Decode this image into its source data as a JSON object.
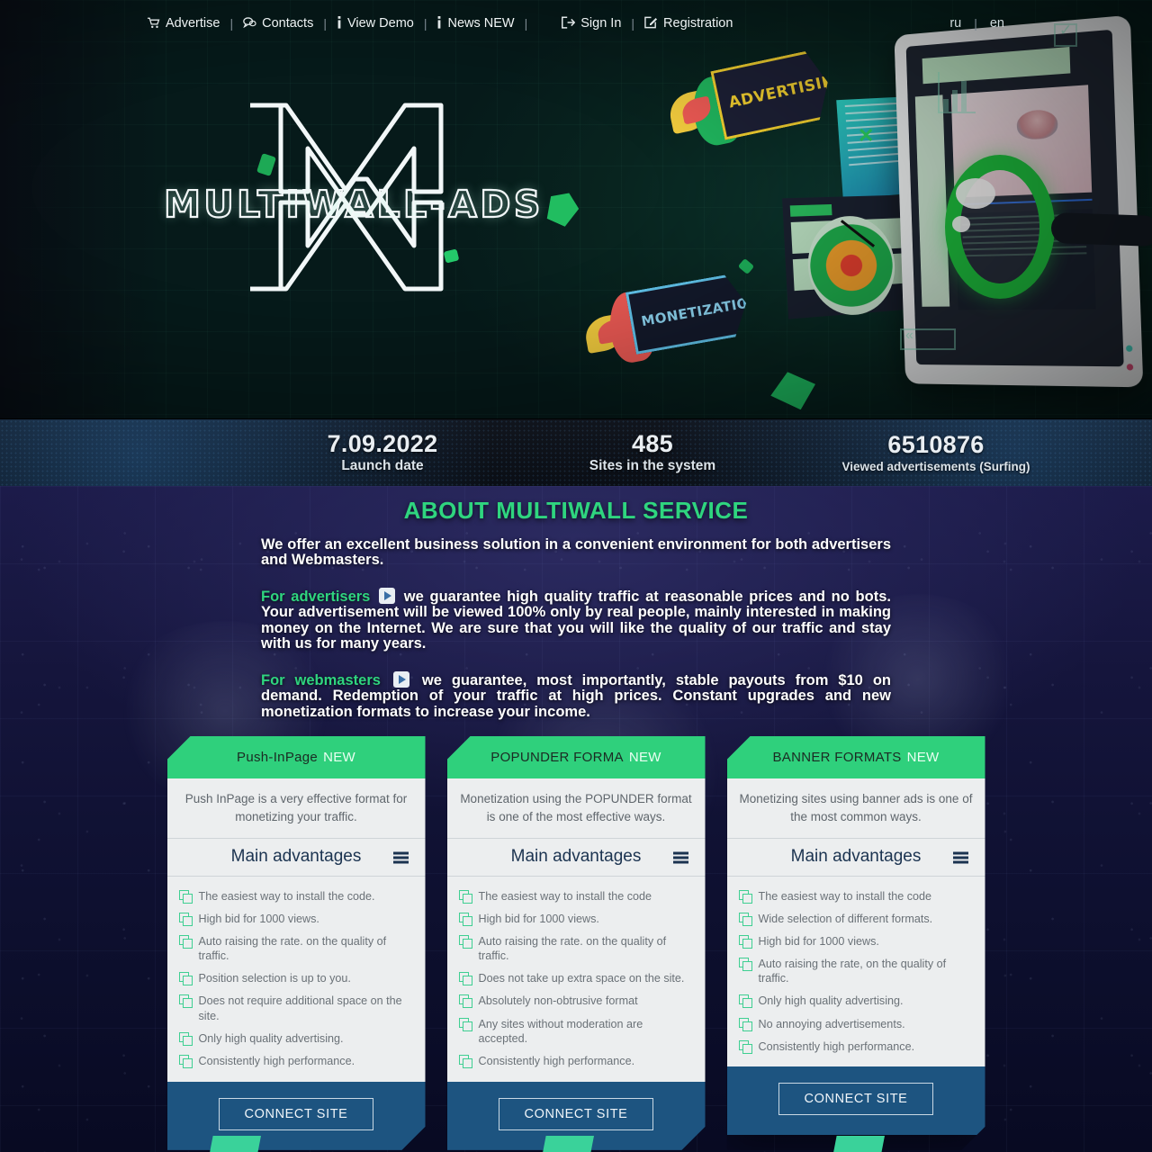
{
  "topnav": {
    "items": [
      {
        "label": "Advertise",
        "icon": "cart-icon",
        "glyph": "🛒"
      },
      {
        "label": "Contacts",
        "icon": "chat-icon",
        "glyph": "💬"
      },
      {
        "label": "View Demo",
        "icon": "info-icon",
        "glyph": "ℹ"
      },
      {
        "label": "News NEW",
        "icon": "info-icon",
        "glyph": "ℹ"
      }
    ],
    "separator": "|",
    "auth": [
      {
        "label": "Sign In",
        "icon": "sign-in-icon",
        "glyph": "➡"
      },
      {
        "label": "Registration",
        "icon": "register-icon",
        "glyph": "✎"
      }
    ],
    "languages": [
      {
        "code": "ru",
        "label": "ru"
      },
      {
        "code": "en",
        "label": "en"
      }
    ]
  },
  "hero": {
    "logo_text": "MULTIWALL-ADS",
    "logo_letter": "M",
    "badge_advertising": "ADVERTISING",
    "badge_monetization": "MONETIZATION"
  },
  "stats": [
    {
      "value": "7.09.2022",
      "label": "Launch date"
    },
    {
      "value": "485",
      "label": "Sites in the system"
    },
    {
      "value": "6510876",
      "label": "Viewed advertisements (Surfing)"
    }
  ],
  "about": {
    "title": "ABOUT MULTIWALL SERVICE",
    "intro": "We offer an excellent business solution in a convenient environment for both advertisers and Webmasters.",
    "advertisers_label": "For advertisers",
    "advertisers_text": "we guarantee high quality traffic at reasonable prices and no bots. Your advertisement will be viewed 100% only by real people, mainly interested in making money on the Internet. We are sure that you will like the quality of our traffic and stay with us for many years.",
    "webmasters_label": "For webmasters",
    "webmasters_text": "we guarantee, most importantly, stable payouts from $10 on demand. Redemption of your traffic at high prices. Constant upgrades and new monetization formats to increase your income."
  },
  "cards": [
    {
      "title": "Push-InPage",
      "badge": "NEW",
      "description": "Push InPage is a very effective format for monetizing your traffic.",
      "advantages_heading": "Main advantages",
      "advantages": [
        "The easiest way to install the code.",
        "High bid for 1000 views.",
        "Auto raising the rate. on the quality of traffic.",
        "Position selection is up to you.",
        "Does not require additional space on the site.",
        "Only high quality advertising.",
        "Consistently high performance."
      ],
      "button": "CONNECT SITE"
    },
    {
      "title": "POPUNDER FORMA",
      "badge": "NEW",
      "description": "Monetization using the POPUNDER format is one of the most effective ways.",
      "advantages_heading": "Main advantages",
      "advantages": [
        "The easiest way to install the code",
        "High bid for 1000 views.",
        "Auto raising the rate. on the quality of traffic.",
        "Does not take up extra space on the site.",
        "Absolutely non-obtrusive format",
        "Any sites without moderation are accepted.",
        "Consistently high performance."
      ],
      "button": "CONNECT SITE"
    },
    {
      "title": "BANNER FORMATS",
      "badge": "NEW",
      "description": "Monetizing sites using banner ads is one of the most common ways.",
      "advantages_heading": "Main advantages",
      "advantages": [
        "The easiest way to install the code",
        "Wide selection of different formats.",
        "High bid for 1000 views.",
        "Auto raising the rate, on the quality of traffic.",
        "Only high quality advertising.",
        "No annoying advertisements.",
        "Consistently high performance."
      ],
      "button": "CONNECT SITE"
    }
  ],
  "colors": {
    "accent_green": "#2fd57f",
    "card_head_green": "#2fd07c",
    "card_foot_blue": "#1d5480",
    "tag_yellow": "#f5d230",
    "tag_blue": "#63c8f0"
  }
}
